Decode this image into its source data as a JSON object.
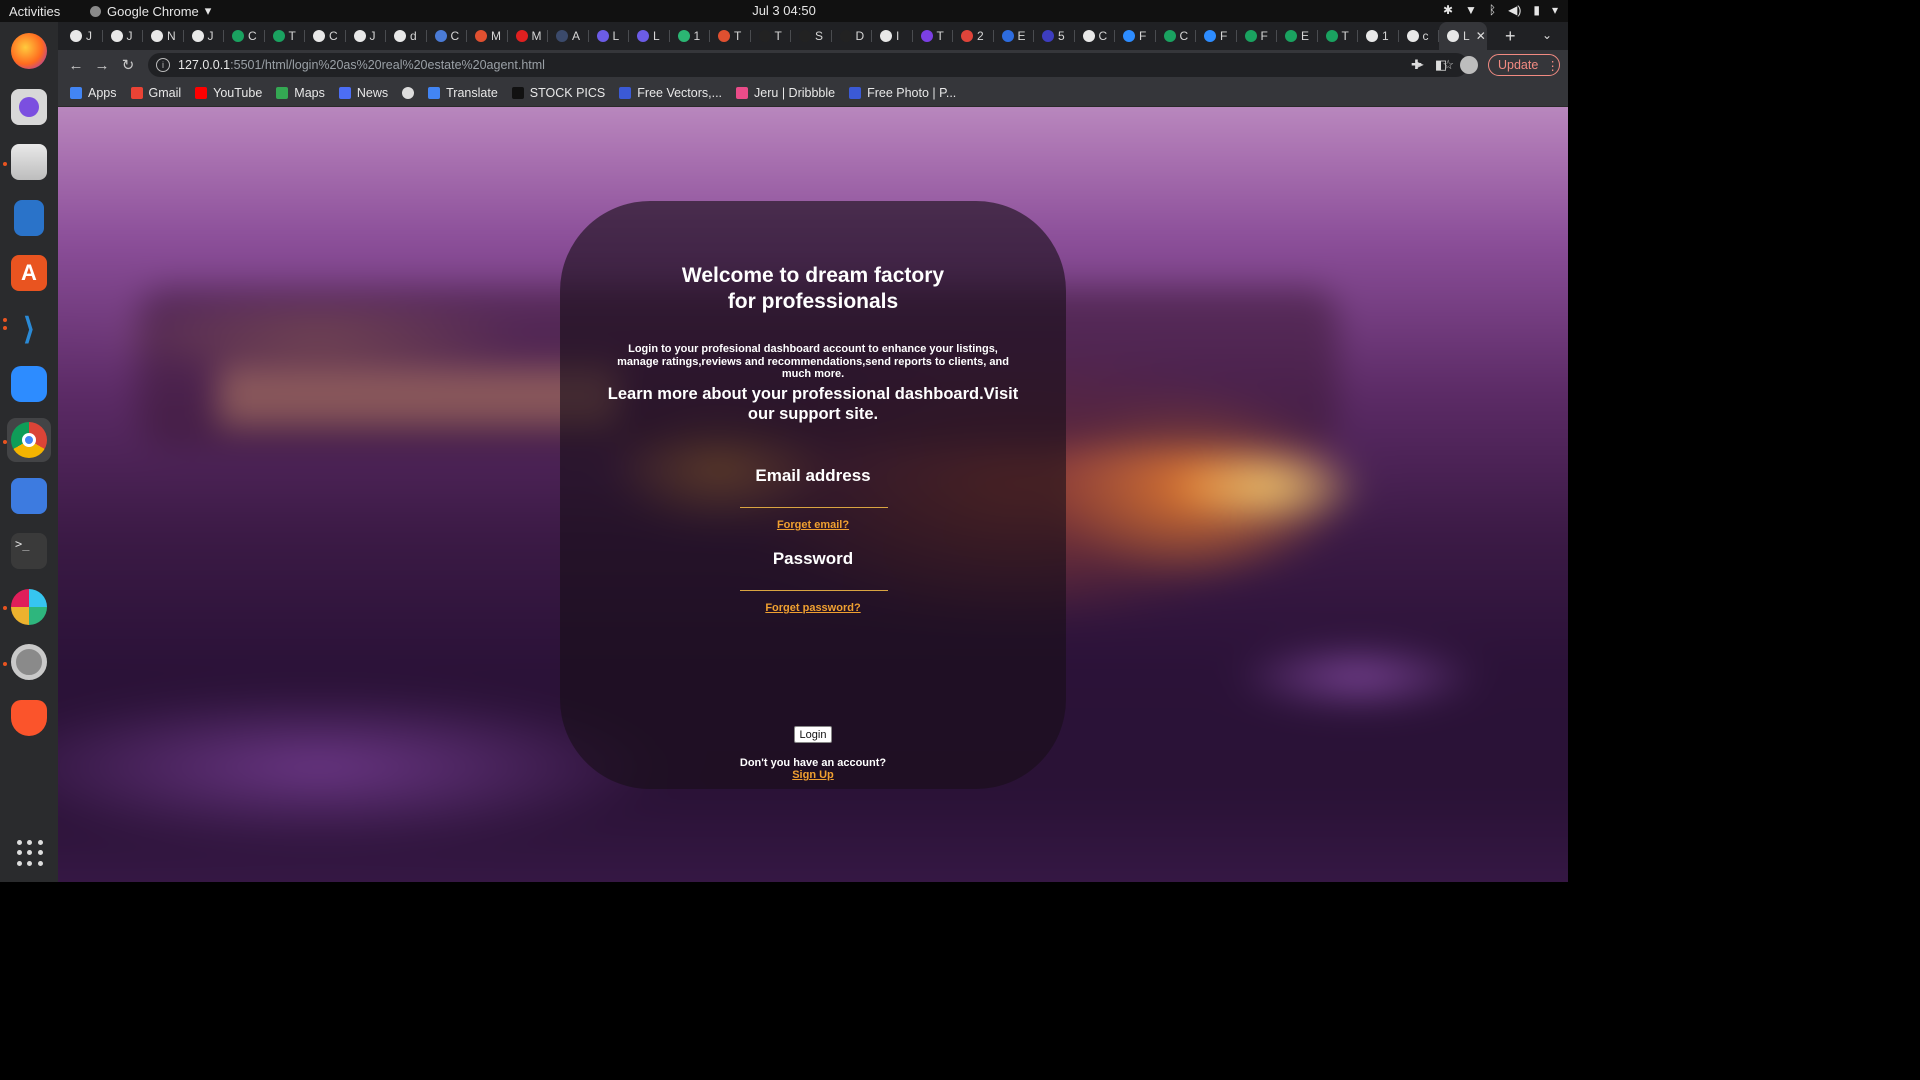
{
  "topbar": {
    "activities": "Activities",
    "app_name": "Google Chrome",
    "clock": "Jul 3  04:50"
  },
  "dock": {
    "apps": [
      "firefox-icon",
      "screen-recorder-icon",
      "files-icon",
      "writer-icon",
      "app-center-icon",
      "vscode-icon",
      "zoom-icon",
      "chrome-icon",
      "screenshot-icon",
      "terminal-icon",
      "slack-icon",
      "settings-icon",
      "brave-icon"
    ]
  },
  "tabs": {
    "items": [
      {
        "letter": "J",
        "color": "#e8e8e8"
      },
      {
        "letter": "J",
        "color": "#e8e8e8"
      },
      {
        "letter": "N",
        "color": "#e8e8e8"
      },
      {
        "letter": "J",
        "color": "#e8e8e8"
      },
      {
        "letter": "C",
        "color": "#1aa260"
      },
      {
        "letter": "T",
        "color": "#1aa260"
      },
      {
        "letter": "C",
        "color": "#e8e8e8"
      },
      {
        "letter": "J",
        "color": "#e8e8e8"
      },
      {
        "letter": "d",
        "color": "#e8e8e8"
      },
      {
        "letter": "C",
        "color": "#4a7bd6"
      },
      {
        "letter": "M",
        "color": "#e05030"
      },
      {
        "letter": "M",
        "color": "#e02020"
      },
      {
        "letter": "A",
        "color": "#3b4a6b"
      },
      {
        "letter": "L",
        "color": "#6c5ce7"
      },
      {
        "letter": "L",
        "color": "#6c5ce7"
      },
      {
        "letter": "1",
        "color": "#2bb673"
      },
      {
        "letter": "T",
        "color": "#e05030"
      },
      {
        "letter": "T",
        "color": "#222222"
      },
      {
        "letter": "S",
        "color": "#222222"
      },
      {
        "letter": "D",
        "color": "#222222"
      },
      {
        "letter": "I",
        "color": "#e8e8e8"
      },
      {
        "letter": "T",
        "color": "#7b3fe4"
      },
      {
        "letter": "2",
        "color": "#e0443a"
      },
      {
        "letter": "E",
        "color": "#2d6cdf"
      },
      {
        "letter": "5",
        "color": "#3d3dbf"
      },
      {
        "letter": "C",
        "color": "#e8e8e8"
      },
      {
        "letter": "F",
        "color": "#2d8cff"
      },
      {
        "letter": "C",
        "color": "#1aa260"
      },
      {
        "letter": "F",
        "color": "#2d8cff"
      },
      {
        "letter": "F",
        "color": "#1aa260"
      },
      {
        "letter": "E",
        "color": "#1aa260"
      },
      {
        "letter": "T",
        "color": "#1aa260"
      },
      {
        "letter": "1",
        "color": "#e8e8e8"
      },
      {
        "letter": "c",
        "color": "#e8e8e8"
      },
      {
        "letter": "L",
        "color": "#e8e8e8"
      }
    ],
    "new_tab": "+"
  },
  "toolbar": {
    "url_host": "127.0.0.1",
    "url_path": ":5501/html/login%20as%20real%20estate%20agent.html",
    "update_label": "Update"
  },
  "bookmarks": [
    {
      "label": "Apps",
      "color": "#4285f4"
    },
    {
      "label": "Gmail",
      "color": "#ea4335"
    },
    {
      "label": "YouTube",
      "color": "#ff0000"
    },
    {
      "label": "Maps",
      "color": "#34a853"
    },
    {
      "label": "News",
      "color": "#4c6ef5"
    },
    {
      "label": "",
      "color": "#dddddd"
    },
    {
      "label": "Translate",
      "color": "#4285f4"
    },
    {
      "label": "STOCK PICS",
      "color": "#111111"
    },
    {
      "label": "Free Vectors,...",
      "color": "#3b5ad6"
    },
    {
      "label": "Jeru | Dribbble",
      "color": "#ea4c89"
    },
    {
      "label": "Free Photo | P...",
      "color": "#3b5ad6"
    }
  ],
  "login": {
    "title_line1": "Welcome to dream factory",
    "title_line2": "for professionals",
    "intro": "Login to your profesional dashboard account to enhance your listings, manage ratings,reviews and recommendations,send reports to clients, and much more.",
    "learn_more": "Learn more about your professional dashboard.Visit our support site.",
    "email_label": "Email address",
    "email_value": "",
    "forget_email": "Forget email?",
    "password_label": "Password",
    "password_value": "",
    "forget_password": "Forget password?",
    "login_button": "Login",
    "no_account": "Don't you have an account?",
    "sign_up": "Sign Up"
  }
}
